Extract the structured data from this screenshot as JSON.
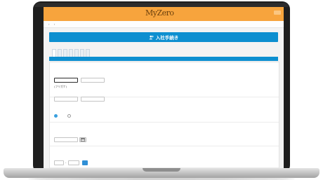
{
  "colors": {
    "header": "#f7a43d",
    "accent": "#0d8fd0",
    "laptop": "#1e1e1e"
  },
  "app": {
    "logo": "MyZero",
    "company_name": "",
    "top_links": [
      "",
      "",
      "",
      ""
    ]
  },
  "breadcrumbs": {
    "items": [
      "",
      "",
      ""
    ],
    "right": ""
  },
  "page_title": "入社手続き",
  "tabs": [
    "",
    "",
    "",
    "",
    "",
    "",
    ""
  ],
  "tab_band_label": "",
  "form": {
    "name_section": {
      "title": "",
      "kanji": {
        "title": "",
        "note": "",
        "last_placeholder": "",
        "first_placeholder": ""
      },
      "kana": {
        "title": "(フリガナ)",
        "note": "",
        "last_placeholder": "",
        "first_placeholder": ""
      }
    },
    "gender": {
      "title": "",
      "options": [
        "",
        ""
      ],
      "selected": 0
    },
    "birthdate": {
      "title": "",
      "note1": "",
      "note2": ""
    },
    "postal": {
      "title": "",
      "note1": "",
      "note2": "",
      "search_label": ""
    },
    "address": {
      "title": ""
    }
  }
}
